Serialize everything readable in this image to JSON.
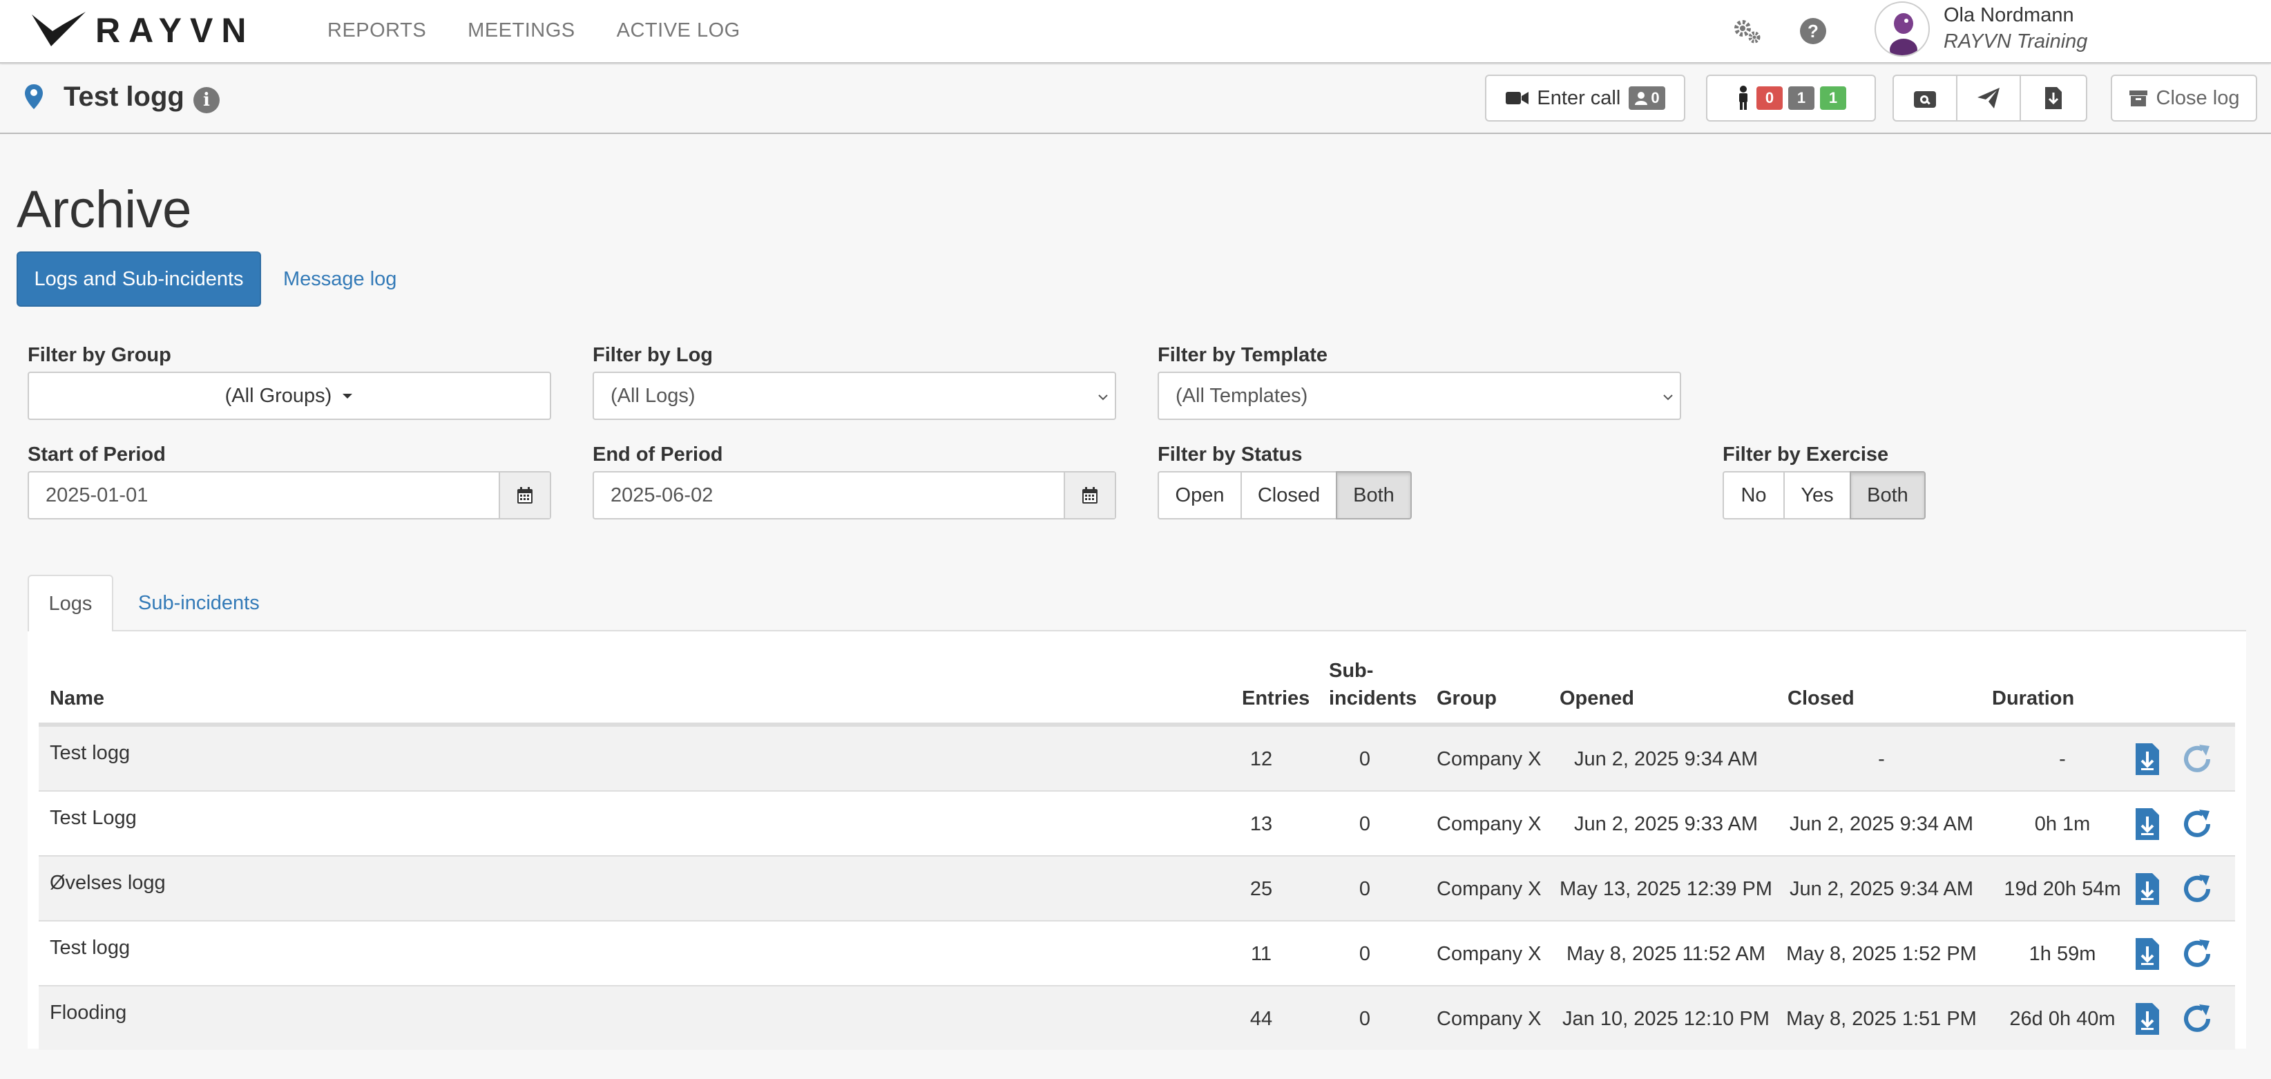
{
  "app": {
    "brand": "RAYVN"
  },
  "nav": {
    "items": [
      "REPORTS",
      "MEETINGS",
      "ACTIVE LOG"
    ]
  },
  "user": {
    "name": "Ola Nordmann",
    "org": "RAYVN Training"
  },
  "log": {
    "title": "Test logg",
    "enter_call_label": "Enter call",
    "call_count": "0",
    "status_counts": {
      "red": "0",
      "gray": "1",
      "green": "1"
    },
    "close_label": "Close log"
  },
  "page": {
    "title": "Archive",
    "tabs": {
      "primary": "Logs and Sub-incidents",
      "secondary": "Message log"
    }
  },
  "filters": {
    "group": {
      "label": "Filter by Group",
      "value": "(All Groups)"
    },
    "log": {
      "label": "Filter by Log",
      "value": "(All Logs)"
    },
    "template": {
      "label": "Filter by Template",
      "value": "(All Templates)"
    },
    "start": {
      "label": "Start of Period",
      "value": "2025-01-01"
    },
    "end": {
      "label": "End of Period",
      "value": "2025-06-02"
    },
    "status": {
      "label": "Filter by Status",
      "options": [
        "Open",
        "Closed",
        "Both"
      ],
      "selected": "Both"
    },
    "exercise": {
      "label": "Filter by Exercise",
      "options": [
        "No",
        "Yes",
        "Both"
      ],
      "selected": "Both"
    }
  },
  "result_tabs": {
    "logs": "Logs",
    "subincidents": "Sub-incidents"
  },
  "table": {
    "headers": {
      "name": "Name",
      "entries": "Entries",
      "sub1": "Sub-",
      "sub2": "incidents",
      "group": "Group",
      "opened": "Opened",
      "closed": "Closed",
      "duration": "Duration"
    },
    "rows": [
      {
        "name": "Test logg",
        "entries": "12",
        "sub": "0",
        "group": "Company X",
        "opened": "Jun 2, 2025 9:34 AM",
        "closed": "-",
        "duration": "-"
      },
      {
        "name": "Test Logg",
        "entries": "13",
        "sub": "0",
        "group": "Company X",
        "opened": "Jun 2, 2025 9:33 AM",
        "closed": "Jun 2, 2025 9:34 AM",
        "duration": "0h 1m"
      },
      {
        "name": "Øvelses logg",
        "entries": "25",
        "sub": "0",
        "group": "Company X",
        "opened": "May 13, 2025 12:39 PM",
        "closed": "Jun 2, 2025 9:34 AM",
        "duration": "19d 20h 54m"
      },
      {
        "name": "Test logg",
        "entries": "11",
        "sub": "0",
        "group": "Company X",
        "opened": "May 8, 2025 11:52 AM",
        "closed": "May 8, 2025 1:52 PM",
        "duration": "1h 59m"
      },
      {
        "name": "Flooding",
        "entries": "44",
        "sub": "0",
        "group": "Company X",
        "opened": "Jan 10, 2025 12:10 PM",
        "closed": "May 8, 2025 1:51 PM",
        "duration": "26d 0h 40m"
      }
    ]
  },
  "colors": {
    "primary": "#337ab7",
    "badge_red": "#d9534f",
    "badge_gray": "#777777",
    "badge_green": "#5cb85c"
  }
}
